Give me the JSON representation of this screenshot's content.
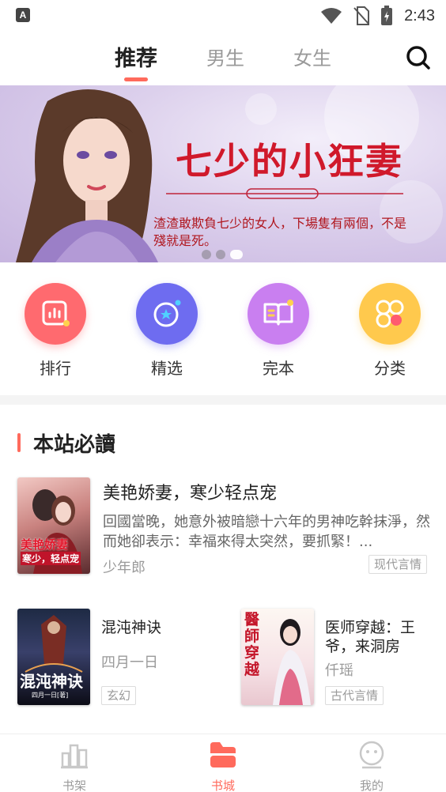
{
  "status_bar": {
    "time": "2:43",
    "app_badge": "A"
  },
  "top_tabs": [
    {
      "label": "推荐",
      "active": true
    },
    {
      "label": "男生",
      "active": false
    },
    {
      "label": "女生",
      "active": false
    }
  ],
  "banner": {
    "title": "七少的小狂妻",
    "subtitle": "渣渣敢欺負七少的女人，下場隻有兩個，不是殘就是死。",
    "dot_count": 3,
    "active_dot": 2
  },
  "categories": [
    {
      "label": "排行",
      "icon": "chart-icon",
      "color": "#ff6a6f"
    },
    {
      "label": "精选",
      "icon": "star-orbit-icon",
      "color": "#6e6cf0"
    },
    {
      "label": "完本",
      "icon": "open-book-icon",
      "color": "#c97ff0"
    },
    {
      "label": "分类",
      "icon": "category-grid-icon",
      "color": "#ffc94d"
    }
  ],
  "section": {
    "title": "本站必讀"
  },
  "featured_book": {
    "title": "美艳娇妻，寒少轻点宠",
    "description": "回國當晚，她意外被暗戀十六年的男神吃幹抹淨，然而她卻表示：幸福來得太突然，要抓緊！...",
    "author": "少年郎",
    "tag": "现代言情",
    "cover_text_1": "美艳娇妻",
    "cover_text_2": "寒少，轻点宠"
  },
  "books": [
    {
      "title": "混沌神诀",
      "author": "四月一日",
      "tag": "玄幻",
      "cover_text": "混沌神诀",
      "cover_author": "四月一日[著]"
    },
    {
      "title": "医师穿越：王爷，来洞房",
      "author": "仟瑶",
      "tag": "古代言情",
      "cover_text": "醫師穿越"
    }
  ],
  "bottom_nav": [
    {
      "label": "书架",
      "icon": "bookshelf-icon",
      "active": false
    },
    {
      "label": "书城",
      "icon": "bookstore-icon",
      "active": true
    },
    {
      "label": "我的",
      "icon": "profile-icon",
      "active": false
    }
  ],
  "colors": {
    "accent": "#ff6a5c",
    "inactive": "#9a9a9a"
  }
}
